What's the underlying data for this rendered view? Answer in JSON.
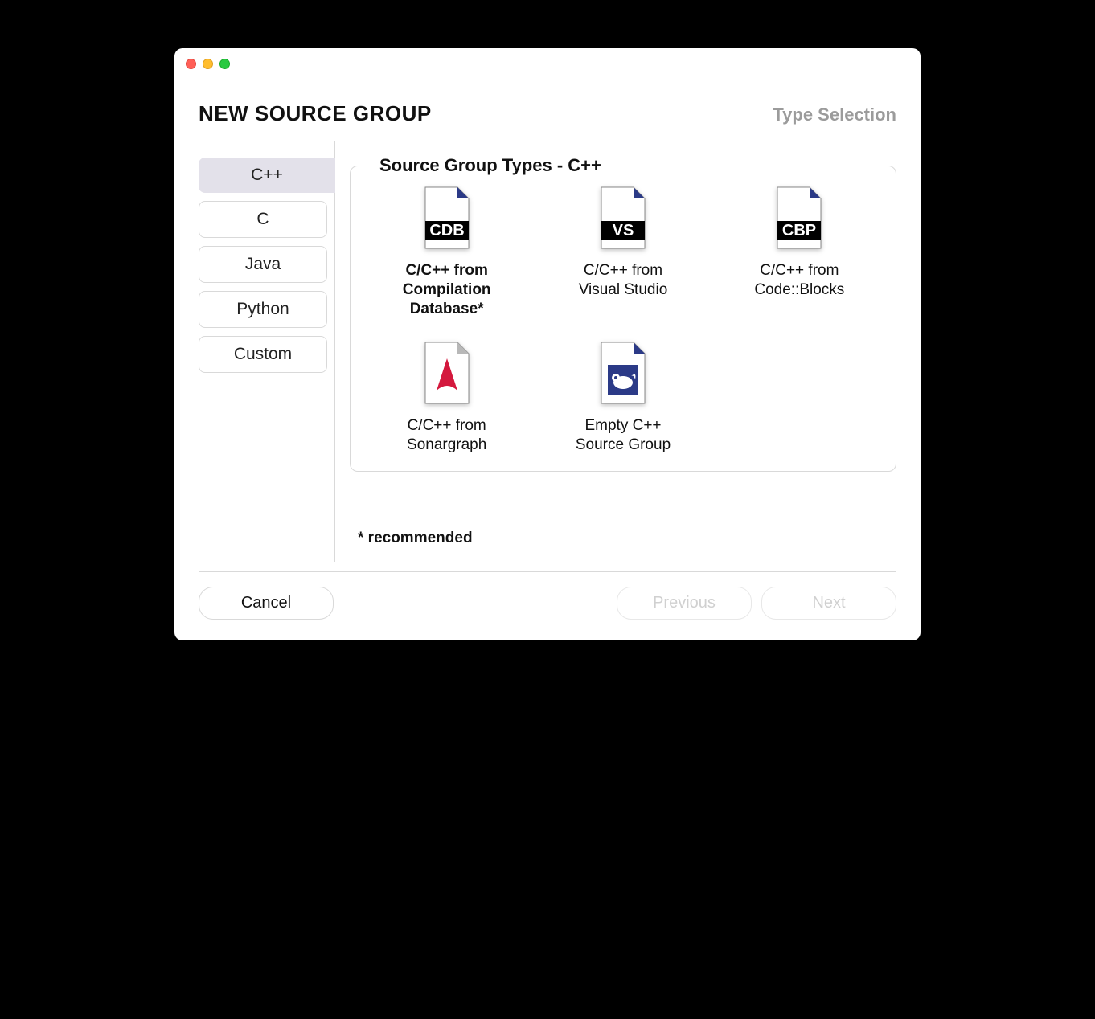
{
  "header": {
    "title": "NEW SOURCE GROUP",
    "subtitle": "Type Selection"
  },
  "sidebar": {
    "items": [
      {
        "label": "C++",
        "selected": true
      },
      {
        "label": "C",
        "selected": false
      },
      {
        "label": "Java",
        "selected": false
      },
      {
        "label": "Python",
        "selected": false
      },
      {
        "label": "Custom",
        "selected": false
      }
    ]
  },
  "group": {
    "legend": "Source Group Types - C++",
    "types": [
      {
        "label": "C/C++ from\nCompilation\nDatabase*",
        "badge": "CDB",
        "icon": "badge",
        "selected": true
      },
      {
        "label": "C/C++ from\nVisual Studio",
        "badge": "VS",
        "icon": "badge",
        "selected": false
      },
      {
        "label": "C/C++ from\nCode::Blocks",
        "badge": "CBP",
        "icon": "badge",
        "selected": false
      },
      {
        "label": "C/C++ from\nSonargraph",
        "badge": "",
        "icon": "sonargraph",
        "selected": false
      },
      {
        "label": "Empty C++\nSource Group",
        "badge": "",
        "icon": "sourcetrail",
        "selected": false
      }
    ]
  },
  "recommended": "* recommended",
  "footer": {
    "cancel": "Cancel",
    "previous": "Previous",
    "next": "Next"
  }
}
